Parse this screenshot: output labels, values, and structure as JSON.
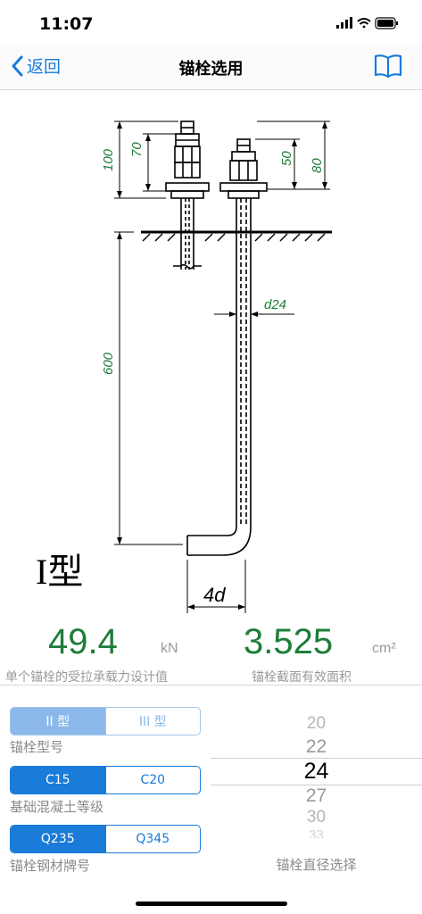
{
  "status": {
    "time": "11:07"
  },
  "nav": {
    "back_label": "返回",
    "title": "锚栓选用"
  },
  "drawing": {
    "dim_100": "100",
    "dim_70": "70",
    "dim_50": "50",
    "dim_80": "80",
    "dim_600": "600",
    "dim_d24": "d24",
    "dim_4d": "4d",
    "type_label": "I型"
  },
  "results": {
    "capacity_value": "49.4",
    "capacity_unit": "kN",
    "capacity_caption": "单个锚栓的受拉承载力设计值",
    "area_value": "3.525",
    "area_unit": "cm²",
    "area_caption": "锚栓截面有效面积"
  },
  "controls": {
    "model": {
      "options": [
        "II 型",
        "III 型"
      ],
      "selected": 0,
      "label": "锚栓型号"
    },
    "concrete": {
      "options": [
        "C15",
        "C20"
      ],
      "selected": 0,
      "label": "基础混凝土等级"
    },
    "steel": {
      "options": [
        "Q235",
        "Q345"
      ],
      "selected": 0,
      "label": "锚栓钢材牌号"
    }
  },
  "picker": {
    "items": [
      "20",
      "22",
      "24",
      "27",
      "30",
      "33"
    ],
    "selected": "24",
    "label": "锚栓直径选择"
  },
  "colors": {
    "accent": "#1a7bd9",
    "value_green": "#1d7d3a",
    "dim_green": "#1d7d3a"
  }
}
